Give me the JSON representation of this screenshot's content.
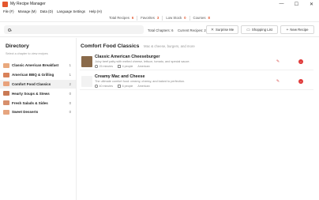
{
  "window": {
    "title": "My Recipe Manager",
    "controls": {
      "minimize": "—",
      "maximize": "☐",
      "close": "✕"
    }
  },
  "menu": [
    "File (F)",
    "Manage (M)",
    "Data (D)",
    "Language Settings",
    "Help (H)"
  ],
  "stats": [
    {
      "label": "Total Recipes",
      "value": "6"
    },
    {
      "label": "Favorites",
      "value": "3"
    },
    {
      "label": "Low Stock",
      "value": "0"
    },
    {
      "label": "Courses",
      "value": "8"
    }
  ],
  "toolbar": {
    "search_placeholder": "",
    "total_chapters": "Total Chapters: 6",
    "current_recipes": "Current Recipes: 2",
    "surprise_label": "Surprise Me",
    "shopping_label": "Shopping List",
    "new_recipe_label": "New Recipe",
    "surprise_icon": "✕",
    "shopping_icon": "▭",
    "new_icon": "+"
  },
  "sidebar": {
    "title": "Directory",
    "subtitle": "Select a chapter to view recipes",
    "items": [
      {
        "label": "Classic American Breakfast",
        "count": "1",
        "color": "#e9a97e"
      },
      {
        "label": "American BBQ & Grilling",
        "count": "1",
        "color": "#d9825a"
      },
      {
        "label": "Comfort Food Classics",
        "count": "2",
        "color": "#e8a27c"
      },
      {
        "label": "Hearty Soups & Stews",
        "count": "0",
        "color": "#c97a55"
      },
      {
        "label": "Fresh Salads & Sides",
        "count": "0",
        "color": "#d78f6c"
      },
      {
        "label": "Sweet Desserts",
        "count": "0",
        "color": "#e6a57f"
      }
    ],
    "active_index": 2
  },
  "main": {
    "title": "Comfort Food Classics",
    "subtitle": "Mac & cheese, burgers, and more",
    "recipes": [
      {
        "name": "Classic American Cheeseburger",
        "description": "Juicy beef patty with melted cheese, lettuce, tomato, and special sauce.",
        "time": "25 minutes",
        "servings": "4 people",
        "cuisine": "American",
        "thumb_color": "#8a6a4a"
      },
      {
        "name": "Creamy Mac and Cheese",
        "description": "The ultimate comfort food: creamy, cheesy, and baked to perfection.",
        "time": "40 minutes",
        "servings": "6 people",
        "cuisine": "American",
        "thumb_color": "#f2f2f2"
      }
    ]
  },
  "colors": {
    "accent": "#e4572e",
    "danger": "#e03b3b"
  }
}
